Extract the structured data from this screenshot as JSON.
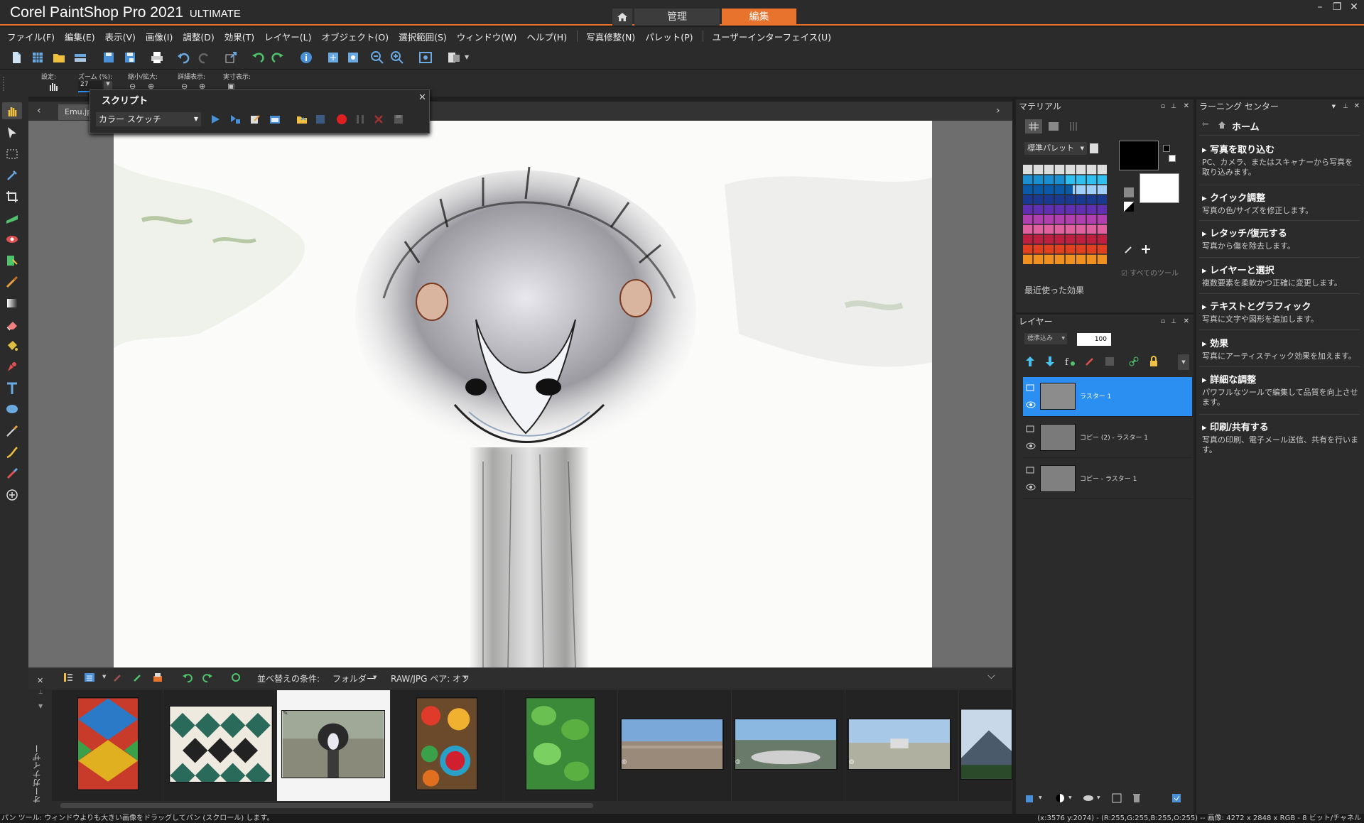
{
  "app": {
    "brand": "Corel",
    "product": "PaintShop",
    "name": "Pro 2021",
    "edition": "ULTIMATE"
  },
  "workspace_tabs": {
    "home_icon": "home-icon",
    "manage": "管理",
    "edit": "編集"
  },
  "window_controls": {
    "minimize": "–",
    "restore": "❐",
    "close": "✕"
  },
  "menu": [
    "ファイル(F)",
    "編集(E)",
    "表示(V)",
    "画像(I)",
    "調整(D)",
    "効果(T)",
    "レイヤー(L)",
    "オブジェクト(O)",
    "選択範囲(S)",
    "ウィンドウ(W)",
    "ヘルプ(H)",
    "写真修整(N)",
    "パレット(P)",
    "ユーザーインターフェイス(U)"
  ],
  "options": {
    "preset_label": "設定:",
    "zoom_label": "ズーム (%):",
    "zoom_value": "27",
    "zoom_inout_label": "縮小/拡大:",
    "detail_label": "詳細表示:",
    "actual_label": "実寸表示:"
  },
  "document": {
    "tab_name": "Emu.jpg"
  },
  "script_panel": {
    "title": "スクリプト",
    "selected": "カラー スケッチ",
    "close": "✕"
  },
  "organizer": {
    "label": "オーガナイザー",
    "sort_label": "並べ替えの条件:",
    "sort_value": "フォルダー",
    "raw_label": "RAW/JPG ペア: オフ",
    "close": "✕",
    "collapse": "⌵"
  },
  "status": {
    "left": "パン ツール: ウィンドウよりも大きい画像をドラッグしてパン (スクロール) します。",
    "right": "(x:3576 y:2074) - (R:255,G:255,B:255,O:255) -- 画像: 4272 x 2848 x RGB - 8 ビット/チャネル"
  },
  "materials": {
    "title": "マテリアル",
    "palette": "標準パレット",
    "recent_label": "最近使った効果",
    "all_tools": "すべてのツール"
  },
  "layers": {
    "title": "レイヤー",
    "blend": "標準込み",
    "opacity": "100",
    "items": [
      {
        "name": "ラスター 1",
        "selected": true
      },
      {
        "name": "コピー (2) - ラスター 1",
        "selected": false
      },
      {
        "name": "コピー - ラスター 1",
        "selected": false
      }
    ]
  },
  "learning": {
    "title": "ラーニング センター",
    "home": "ホーム",
    "items": [
      {
        "title": "写真を取り込む",
        "desc": "PC、カメラ、またはスキャナーから写真を取り込みます。"
      },
      {
        "title": "クイック調整",
        "desc": "写真の色/サイズを修正します。"
      },
      {
        "title": "レタッチ/復元する",
        "desc": "写真から傷を除去します。"
      },
      {
        "title": "レイヤーと選択",
        "desc": "複数要素を柔軟かつ正確に変更します。"
      },
      {
        "title": "テキストとグラフィック",
        "desc": "写真に文字や図形を追加します。"
      },
      {
        "title": "効果",
        "desc": "写真にアーティスティック効果を加えます。"
      },
      {
        "title": "詳細な調整",
        "desc": "パワフルなツールで編集して品質を向上させます。"
      },
      {
        "title": "印刷/共有する",
        "desc": "写真の印刷、電子メール送信、共有を行います。"
      }
    ]
  },
  "colors": {
    "accent": "#e8732c",
    "selection": "#2a8ff0",
    "record": "#e02020"
  }
}
